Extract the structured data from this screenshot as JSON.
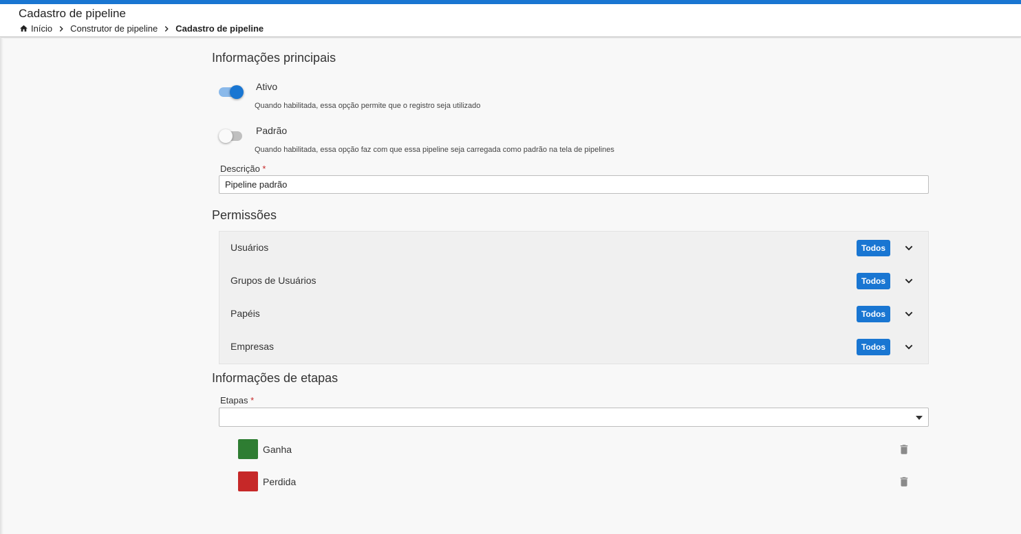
{
  "header": {
    "title": "Cadastro de pipeline",
    "breadcrumb": {
      "home": "Início",
      "parent": "Construtor de pipeline",
      "current": "Cadastro de pipeline"
    }
  },
  "main_info": {
    "title": "Informações principais",
    "active": {
      "label": "Ativo",
      "help": "Quando habilitada, essa opção permite que o registro seja utilizado",
      "enabled": true
    },
    "default": {
      "label": "Padrão",
      "help": "Quando habilitada, essa opção faz com que essa pipeline seja carregada como padrão na tela de pipelines",
      "enabled": false
    },
    "description": {
      "label": "Descrição",
      "required_mark": "*",
      "value": "Pipeline padrão"
    }
  },
  "permissions": {
    "title": "Permissões",
    "rows": [
      {
        "label": "Usuários",
        "badge": "Todos"
      },
      {
        "label": "Grupos de Usuários",
        "badge": "Todos"
      },
      {
        "label": "Papéis",
        "badge": "Todos"
      },
      {
        "label": "Empresas",
        "badge": "Todos"
      }
    ]
  },
  "stages_info": {
    "title": "Informações de etapas",
    "field_label": "Etapas",
    "required_mark": "*",
    "selected": "",
    "stages": [
      {
        "name": "Ganha",
        "color": "#2e7d32"
      },
      {
        "name": "Perdida",
        "color": "#c62828"
      }
    ]
  },
  "colors": {
    "primary": "#1976d2"
  }
}
